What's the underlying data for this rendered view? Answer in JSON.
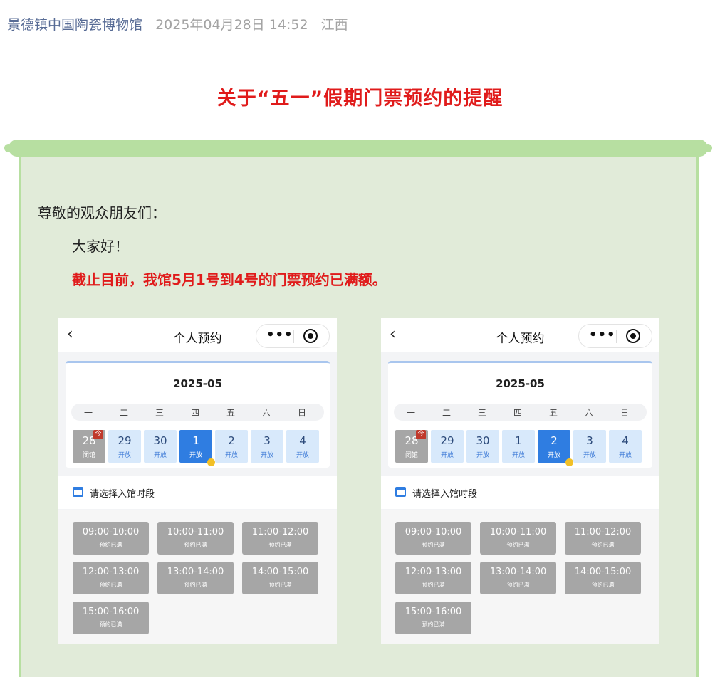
{
  "meta": {
    "account": "景德镇中国陶瓷博物馆",
    "date": "2025年04月28日 14:52",
    "location": "江西"
  },
  "article": {
    "title": "关于“五一”假期门票预约的提醒",
    "greeting": "尊敬的观众朋友们：",
    "hello": "大家好！",
    "alert": "截止目前，我馆5月1号到4号的门票预约已满额。"
  },
  "colors": {
    "title_red": "#e01b1b",
    "notice_bg": "#e1ebd9",
    "notice_border": "#b7dfa1",
    "selected_blue": "#2f7de1"
  },
  "phones": [
    {
      "header_title": "个人预约",
      "back_icon": "‹",
      "menu_icon": "•••",
      "month": "2025-05",
      "weekdays": [
        "一",
        "二",
        "三",
        "四",
        "五",
        "六",
        "日"
      ],
      "days": [
        {
          "num": "28",
          "status": "闭馆",
          "kind": "closed",
          "today_badge": "今"
        },
        {
          "num": "29",
          "status": "开放",
          "kind": "open"
        },
        {
          "num": "30",
          "status": "开放",
          "kind": "open"
        },
        {
          "num": "1",
          "status": "开放",
          "kind": "selected"
        },
        {
          "num": "2",
          "status": "开放",
          "kind": "open"
        },
        {
          "num": "3",
          "status": "开放",
          "kind": "open"
        },
        {
          "num": "4",
          "status": "开放",
          "kind": "open"
        }
      ],
      "section_label": "请选择入馆时段",
      "slots": [
        {
          "time": "09:00-10:00",
          "state": "预约已满"
        },
        {
          "time": "10:00-11:00",
          "state": "预约已满"
        },
        {
          "time": "11:00-12:00",
          "state": "预约已满"
        },
        {
          "time": "12:00-13:00",
          "state": "预约已满"
        },
        {
          "time": "13:00-14:00",
          "state": "预约已满"
        },
        {
          "time": "14:00-15:00",
          "state": "预约已满"
        },
        {
          "time": "15:00-16:00",
          "state": "预约已满"
        }
      ]
    },
    {
      "header_title": "个人预约",
      "back_icon": "‹",
      "menu_icon": "•••",
      "month": "2025-05",
      "weekdays": [
        "一",
        "二",
        "三",
        "四",
        "五",
        "六",
        "日"
      ],
      "days": [
        {
          "num": "28",
          "status": "闭馆",
          "kind": "closed",
          "today_badge": "今"
        },
        {
          "num": "29",
          "status": "开放",
          "kind": "open"
        },
        {
          "num": "30",
          "status": "开放",
          "kind": "open"
        },
        {
          "num": "1",
          "status": "开放",
          "kind": "open"
        },
        {
          "num": "2",
          "status": "开放",
          "kind": "selected"
        },
        {
          "num": "3",
          "status": "开放",
          "kind": "open"
        },
        {
          "num": "4",
          "status": "开放",
          "kind": "open"
        }
      ],
      "section_label": "请选择入馆时段",
      "slots": [
        {
          "time": "09:00-10:00",
          "state": "预约已满"
        },
        {
          "time": "10:00-11:00",
          "state": "预约已满"
        },
        {
          "time": "11:00-12:00",
          "state": "预约已满"
        },
        {
          "time": "12:00-13:00",
          "state": "预约已满"
        },
        {
          "time": "13:00-14:00",
          "state": "预约已满"
        },
        {
          "time": "14:00-15:00",
          "state": "预约已满"
        },
        {
          "time": "15:00-16:00",
          "state": "预约已满"
        }
      ]
    }
  ]
}
